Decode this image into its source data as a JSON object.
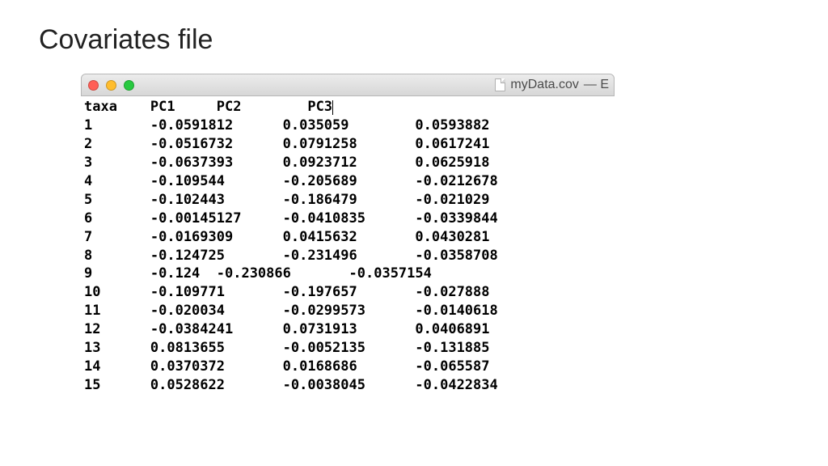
{
  "slide": {
    "title": "Covariates file"
  },
  "window": {
    "filename": "myData.cov",
    "title_suffix": " — E"
  },
  "file": {
    "header": [
      "taxa",
      "PC1",
      "PC2",
      "PC3"
    ],
    "rows": [
      [
        "1",
        "-0.0591812",
        "0.035059",
        "0.0593882"
      ],
      [
        "2",
        "-0.0516732",
        "0.0791258",
        "0.0617241"
      ],
      [
        "3",
        "-0.0637393",
        "0.0923712",
        "0.0625918"
      ],
      [
        "4",
        "-0.109544",
        "-0.205689",
        "-0.0212678"
      ],
      [
        "5",
        "-0.102443",
        "-0.186479",
        "-0.021029"
      ],
      [
        "6",
        "-0.00145127",
        "-0.0410835",
        "-0.0339844"
      ],
      [
        "7",
        "-0.0169309",
        "0.0415632",
        "0.0430281"
      ],
      [
        "8",
        "-0.124725",
        "-0.231496",
        "-0.0358708"
      ],
      [
        "9",
        "-0.124",
        "-0.230866",
        "-0.0357154"
      ],
      [
        "10",
        "-0.109771",
        "-0.197657",
        "-0.027888"
      ],
      [
        "11",
        "-0.020034",
        "-0.0299573",
        "-0.0140618"
      ],
      [
        "12",
        "-0.0384241",
        "0.0731913",
        "0.0406891"
      ],
      [
        "13",
        "0.0813655",
        "-0.0052135",
        "-0.131885"
      ],
      [
        "14",
        "0.0370372",
        "0.0168686",
        "-0.065587"
      ],
      [
        "15",
        "0.0528622",
        "-0.0038045",
        "-0.0422834"
      ]
    ]
  },
  "chart_data": {
    "type": "table",
    "title": "Covariates file (myData.cov)",
    "columns": [
      "taxa",
      "PC1",
      "PC2",
      "PC3"
    ],
    "rows": [
      [
        1,
        -0.0591812,
        0.035059,
        0.0593882
      ],
      [
        2,
        -0.0516732,
        0.0791258,
        0.0617241
      ],
      [
        3,
        -0.0637393,
        0.0923712,
        0.0625918
      ],
      [
        4,
        -0.109544,
        -0.205689,
        -0.0212678
      ],
      [
        5,
        -0.102443,
        -0.186479,
        -0.021029
      ],
      [
        6,
        -0.00145127,
        -0.0410835,
        -0.0339844
      ],
      [
        7,
        -0.0169309,
        0.0415632,
        0.0430281
      ],
      [
        8,
        -0.124725,
        -0.231496,
        -0.0358708
      ],
      [
        9,
        -0.124,
        -0.230866,
        -0.0357154
      ],
      [
        10,
        -0.109771,
        -0.197657,
        -0.027888
      ],
      [
        11,
        -0.020034,
        -0.0299573,
        -0.0140618
      ],
      [
        12,
        -0.0384241,
        0.0731913,
        0.0406891
      ],
      [
        13,
        0.0813655,
        -0.0052135,
        -0.131885
      ],
      [
        14,
        0.0370372,
        0.0168686,
        -0.065587
      ],
      [
        15,
        0.0528622,
        -0.0038045,
        -0.0422834
      ]
    ]
  }
}
